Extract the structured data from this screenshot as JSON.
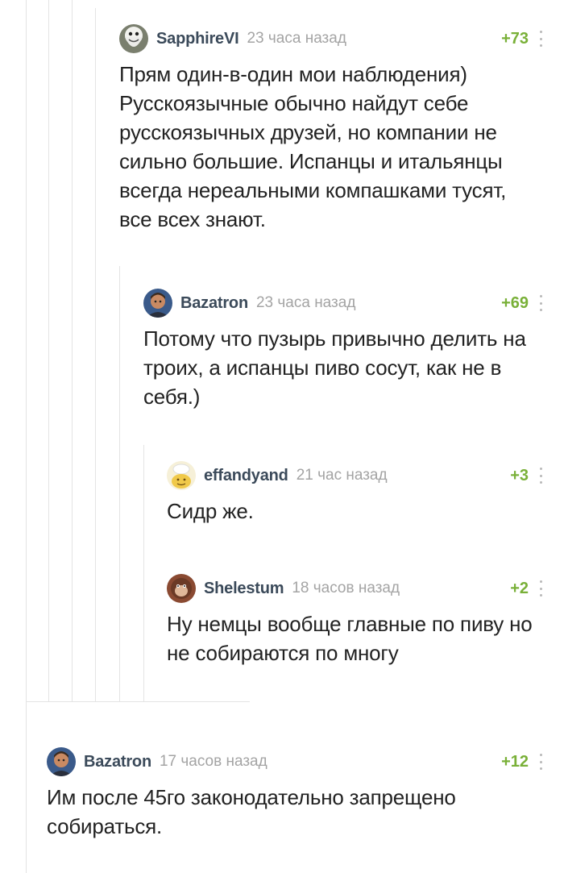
{
  "colors": {
    "username": "#3b4a5a",
    "time": "#a4a4a4",
    "rating_positive": "#79b038",
    "text": "#222222",
    "thread_line": "#e4e4e4"
  },
  "comments": [
    {
      "username": "SapphireVI",
      "time": "23 часа назад",
      "rating": "+73",
      "avatar_icon": "ghost-avatar-icon",
      "text": "Прям один-в-один мои наблюдения) Русскоязычные обычно найдут себе русскоязычных друзей, но компании не сильно большие. Испанцы и итальянцы всегда нереальными компашками тусят, все всех знают."
    },
    {
      "username": "Bazatron",
      "time": "23 часа назад",
      "rating": "+69",
      "avatar_icon": "man-avatar-icon",
      "text": "Потому что пузырь привычно делить на троих, а испанцы пиво сосут, как не в себя.)"
    },
    {
      "username": "effandyand",
      "time": "21 час назад",
      "rating": "+3",
      "avatar_icon": "chef-avatar-icon",
      "text": "Сидр же."
    },
    {
      "username": "Shelestum",
      "time": "18 часов назад",
      "rating": "+2",
      "avatar_icon": "monkey-avatar-icon",
      "text": "Ну немцы вообще главные по пиву но не собираются по многу"
    },
    {
      "username": "Bazatron",
      "time": "17 часов назад",
      "rating": "+12",
      "avatar_icon": "man-avatar-icon",
      "text": "Им после 45го законодательно запрещено собираться."
    }
  ]
}
